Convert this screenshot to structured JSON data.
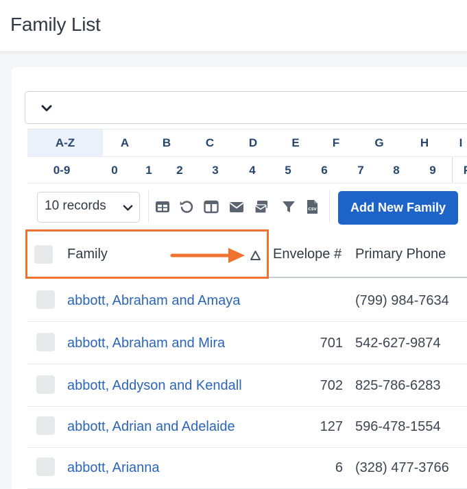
{
  "header": {
    "title": "Family List"
  },
  "alpha": {
    "row1": [
      "A-Z",
      "A",
      "B",
      "C",
      "D",
      "E",
      "F",
      "G",
      "H",
      "I"
    ],
    "row2": [
      "0-9",
      "0",
      "1",
      "2",
      "3",
      "4",
      "5",
      "6",
      "7",
      "8",
      "9",
      "F"
    ],
    "active": "A-Z"
  },
  "toolbar": {
    "records_select": "10 records",
    "icons": [
      "table-view-icon",
      "reset-icon",
      "columns-icon",
      "email-icon",
      "mail-merge-icon",
      "filter-icon",
      "csv-export-icon"
    ],
    "add_button": "Add New Family"
  },
  "table": {
    "columns": {
      "family": "Family",
      "envelope": "Envelope #",
      "phone": "Primary Phone"
    },
    "rows": [
      {
        "family": "abbott, Abraham and Amaya",
        "envelope": "",
        "phone": "(799) 984-7634"
      },
      {
        "family": "abbott, Abraham and Mira",
        "envelope": "701",
        "phone": "542-627-9874"
      },
      {
        "family": "abbott, Addyson and Kendall",
        "envelope": "702",
        "phone": "825-786-6283"
      },
      {
        "family": "abbott, Adrian and Adelaide",
        "envelope": "127",
        "phone": "596-478-1554"
      },
      {
        "family": "abbott, Arianna",
        "envelope": "6",
        "phone": "(328) 477-3766"
      }
    ]
  },
  "colors": {
    "primary": "#1e63c8",
    "link": "#2b65b8",
    "annotation": "#ef7231",
    "active_letter_bg": "#eaf1fb"
  }
}
